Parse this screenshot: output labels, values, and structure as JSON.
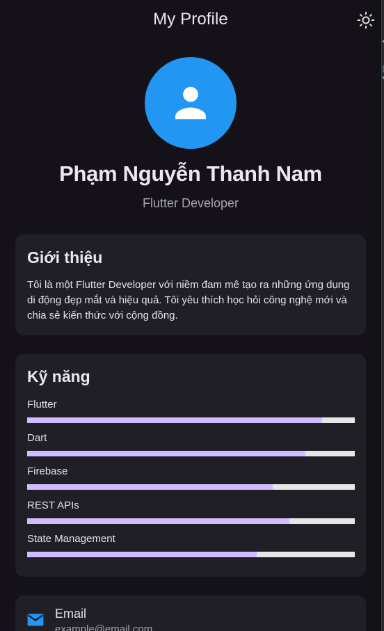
{
  "appbar": {
    "title": "My Profile",
    "theme_icon": "sun-icon"
  },
  "profile": {
    "avatar_icon": "person-icon",
    "name": "Phạm Nguyễn Thanh Nam",
    "role": "Flutter Developer"
  },
  "intro": {
    "title": "Giới thiệu",
    "text": "Tôi là một Flutter Developer với niềm đam mê tạo ra những ứng dụng di động đẹp mắt và hiệu quả. Tôi yêu thích học hỏi công nghệ mới và chia sẻ kiến thức với cộng đồng."
  },
  "skills": {
    "title": "Kỹ năng",
    "items": [
      {
        "label": "Flutter",
        "level": 0.9
      },
      {
        "label": "Dart",
        "level": 0.85
      },
      {
        "label": "Firebase",
        "level": 0.75
      },
      {
        "label": "REST APIs",
        "level": 0.8
      },
      {
        "label": "State Management",
        "level": 0.7
      }
    ]
  },
  "contact": {
    "label": "Email",
    "value": "example@email.com",
    "icon": "mail-icon"
  },
  "colors": {
    "background": "#141218",
    "card": "#211f26",
    "accent": "#d0bcff",
    "avatar": "#2196f3"
  }
}
